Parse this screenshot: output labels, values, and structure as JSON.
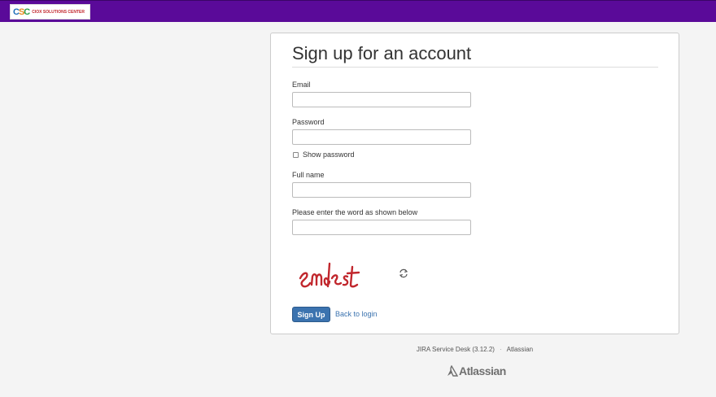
{
  "header": {
    "logo_mark": {
      "c1": "C",
      "s": "S",
      "c2": "C"
    },
    "logo_text": "CIOX SOLUTIONS CENTER",
    "bar_color": "#5a0a99"
  },
  "form": {
    "title": "Sign up for an account",
    "email_label": "Email",
    "email_value": "",
    "password_label": "Password",
    "password_value": "",
    "show_password_label": "Show password",
    "show_password_checked": false,
    "fullname_label": "Full name",
    "fullname_value": "",
    "captcha_label": "Please enter the word as shown below",
    "captcha_value": "",
    "captcha_image_text": "emdest",
    "refresh_icon": "refresh-icon",
    "submit_label": "Sign Up",
    "back_link_label": "Back to login",
    "accent_color": "#3b73af"
  },
  "footer": {
    "product": "JIRA Service Desk (3.12.2)",
    "separator": "·",
    "vendor": "Atlassian",
    "brand": "Atlassian"
  }
}
